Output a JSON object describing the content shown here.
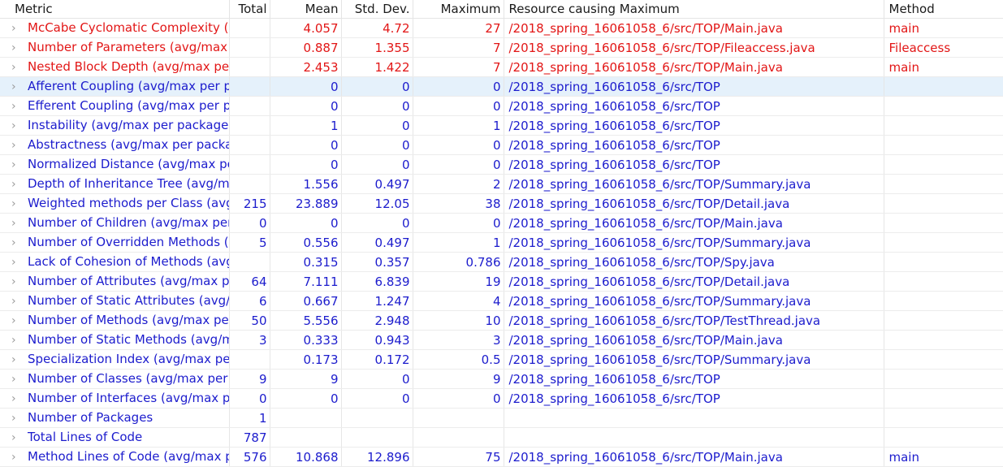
{
  "columns": [
    "Metric",
    "Total",
    "Mean",
    "Std. Dev.",
    "Maximum",
    "Resource causing Maximum",
    "Method"
  ],
  "rows": [
    {
      "metric": "McCabe Cyclomatic Complexity (a",
      "total": "",
      "mean": "4.057",
      "std": "4.72",
      "max": "27",
      "resource": "/2018_spring_16061058_6/src/TOP/Main.java",
      "method": "main",
      "error": true
    },
    {
      "metric": "Number of Parameters (avg/max p",
      "total": "",
      "mean": "0.887",
      "std": "1.355",
      "max": "7",
      "resource": "/2018_spring_16061058_6/src/TOP/Fileaccess.java",
      "method": "Fileaccess",
      "error": true
    },
    {
      "metric": "Nested Block Depth (avg/max per",
      "total": "",
      "mean": "2.453",
      "std": "1.422",
      "max": "7",
      "resource": "/2018_spring_16061058_6/src/TOP/Main.java",
      "method": "main",
      "error": true
    },
    {
      "metric": "Afferent Coupling (avg/max per p",
      "total": "",
      "mean": "0",
      "std": "0",
      "max": "0",
      "resource": "/2018_spring_16061058_6/src/TOP",
      "method": "",
      "selected": true
    },
    {
      "metric": "Efferent Coupling (avg/max per pa",
      "total": "",
      "mean": "0",
      "std": "0",
      "max": "0",
      "resource": "/2018_spring_16061058_6/src/TOP",
      "method": ""
    },
    {
      "metric": "Instability (avg/max per packageFi",
      "total": "",
      "mean": "1",
      "std": "0",
      "max": "1",
      "resource": "/2018_spring_16061058_6/src/TOP",
      "method": ""
    },
    {
      "metric": "Abstractness (avg/max per packag",
      "total": "",
      "mean": "0",
      "std": "0",
      "max": "0",
      "resource": "/2018_spring_16061058_6/src/TOP",
      "method": ""
    },
    {
      "metric": "Normalized Distance (avg/max pe",
      "total": "",
      "mean": "0",
      "std": "0",
      "max": "0",
      "resource": "/2018_spring_16061058_6/src/TOP",
      "method": ""
    },
    {
      "metric": "Depth of Inheritance Tree (avg/ma",
      "total": "",
      "mean": "1.556",
      "std": "0.497",
      "max": "2",
      "resource": "/2018_spring_16061058_6/src/TOP/Summary.java",
      "method": ""
    },
    {
      "metric": "Weighted methods per Class (avg",
      "total": "215",
      "mean": "23.889",
      "std": "12.05",
      "max": "38",
      "resource": "/2018_spring_16061058_6/src/TOP/Detail.java",
      "method": ""
    },
    {
      "metric": "Number of Children (avg/max per",
      "total": "0",
      "mean": "0",
      "std": "0",
      "max": "0",
      "resource": "/2018_spring_16061058_6/src/TOP/Main.java",
      "method": ""
    },
    {
      "metric": "Number of Overridden Methods (",
      "total": "5",
      "mean": "0.556",
      "std": "0.497",
      "max": "1",
      "resource": "/2018_spring_16061058_6/src/TOP/Summary.java",
      "method": ""
    },
    {
      "metric": "Lack of Cohesion of Methods (avg",
      "total": "",
      "mean": "0.315",
      "std": "0.357",
      "max": "0.786",
      "resource": "/2018_spring_16061058_6/src/TOP/Spy.java",
      "method": ""
    },
    {
      "metric": "Number of Attributes (avg/max pe",
      "total": "64",
      "mean": "7.111",
      "std": "6.839",
      "max": "19",
      "resource": "/2018_spring_16061058_6/src/TOP/Detail.java",
      "method": ""
    },
    {
      "metric": "Number of Static Attributes (avg/",
      "total": "6",
      "mean": "0.667",
      "std": "1.247",
      "max": "4",
      "resource": "/2018_spring_16061058_6/src/TOP/Summary.java",
      "method": ""
    },
    {
      "metric": "Number of Methods (avg/max per",
      "total": "50",
      "mean": "5.556",
      "std": "2.948",
      "max": "10",
      "resource": "/2018_spring_16061058_6/src/TOP/TestThread.java",
      "method": ""
    },
    {
      "metric": "Number of Static Methods (avg/m",
      "total": "3",
      "mean": "0.333",
      "std": "0.943",
      "max": "3",
      "resource": "/2018_spring_16061058_6/src/TOP/Main.java",
      "method": ""
    },
    {
      "metric": "Specialization Index (avg/max per",
      "total": "",
      "mean": "0.173",
      "std": "0.172",
      "max": "0.5",
      "resource": "/2018_spring_16061058_6/src/TOP/Summary.java",
      "method": ""
    },
    {
      "metric": "Number of Classes (avg/max per p",
      "total": "9",
      "mean": "9",
      "std": "0",
      "max": "9",
      "resource": "/2018_spring_16061058_6/src/TOP",
      "method": ""
    },
    {
      "metric": "Number of Interfaces (avg/max pe",
      "total": "0",
      "mean": "0",
      "std": "0",
      "max": "0",
      "resource": "/2018_spring_16061058_6/src/TOP",
      "method": ""
    },
    {
      "metric": "Number of Packages",
      "total": "1",
      "mean": "",
      "std": "",
      "max": "",
      "resource": "",
      "method": ""
    },
    {
      "metric": "Total Lines of Code",
      "total": "787",
      "mean": "",
      "std": "",
      "max": "",
      "resource": "",
      "method": ""
    },
    {
      "metric": "Method Lines of Code (avg/max p",
      "total": "576",
      "mean": "10.868",
      "std": "12.896",
      "max": "75",
      "resource": "/2018_spring_16061058_6/src/TOP/Main.java",
      "method": "main"
    }
  ],
  "icons": {
    "expand": "chevron-right-icon"
  },
  "colors": {
    "normal": "#1c1ccd",
    "error": "#e21616",
    "selected_bg": "#e5f1fb"
  }
}
